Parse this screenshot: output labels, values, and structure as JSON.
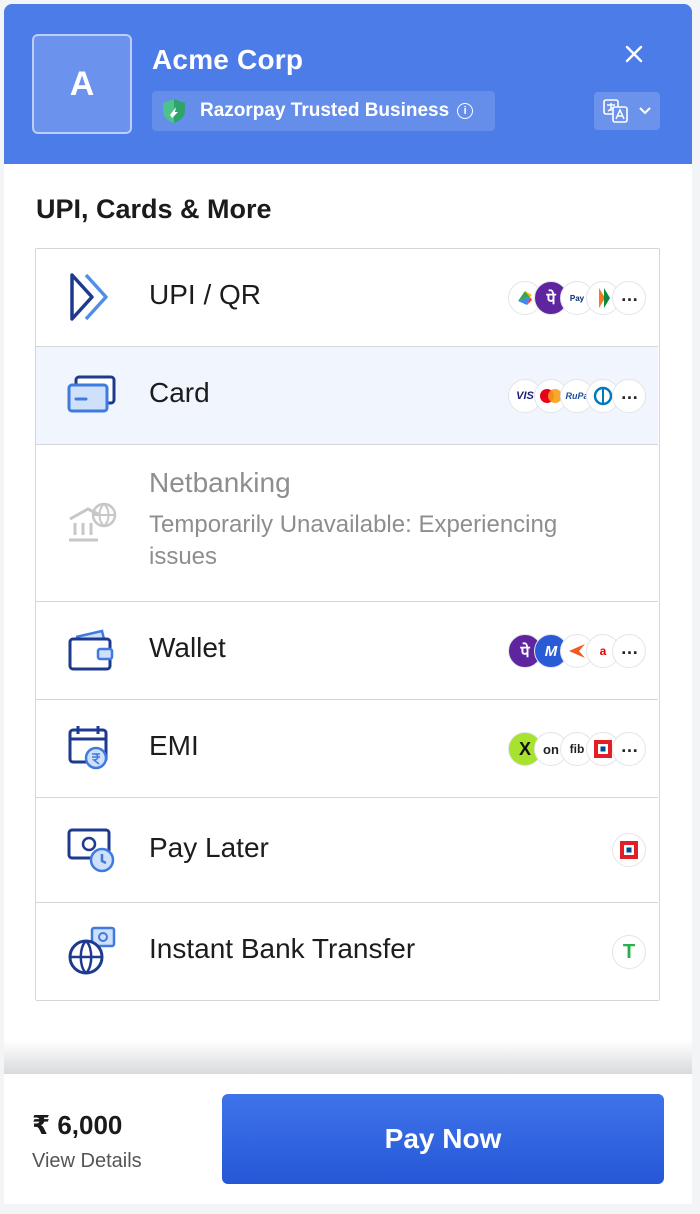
{
  "header": {
    "logo_letter": "A",
    "merchant_name": "Acme Corp",
    "trust_badge": "Razorpay Trusted Business",
    "info_glyph": "i"
  },
  "section_title": "UPI, Cards & More",
  "methods": [
    {
      "label": "UPI / QR",
      "icon": "upi-icon",
      "chips": [
        "gpay",
        "phonepe",
        "paytm",
        "bhim",
        "more"
      ]
    },
    {
      "label": "Card",
      "icon": "card-icon",
      "selected": true,
      "chips": [
        "VIS",
        "mastercard",
        "RuPay",
        "diners",
        "more"
      ]
    },
    {
      "label": "Netbanking",
      "icon": "bank-icon",
      "disabled": true,
      "sublabel": "Temporarily Unavailable: Experiencing issues"
    },
    {
      "label": "Wallet",
      "icon": "wallet-icon",
      "chips": [
        "phonepe",
        "mobikwik",
        "freecharge",
        "airtel",
        "more"
      ]
    },
    {
      "label": "EMI",
      "icon": "emi-icon",
      "chips": [
        "X",
        "on",
        "fib",
        "hdfc",
        "more"
      ]
    },
    {
      "label": "Pay Later",
      "icon": "paylater-icon",
      "chips": [
        "hdfc"
      ]
    },
    {
      "label": "Instant Bank Transfer",
      "icon": "bank-transfer-icon",
      "chips": [
        "T"
      ]
    }
  ],
  "footer": {
    "amount": "₹ 6,000",
    "view_details": "View Details",
    "pay_button": "Pay Now"
  },
  "colors": {
    "header_bg": "#4c7ce8",
    "primary_button": "#2f63df",
    "selected_row_bg": "#f1f5fe"
  }
}
